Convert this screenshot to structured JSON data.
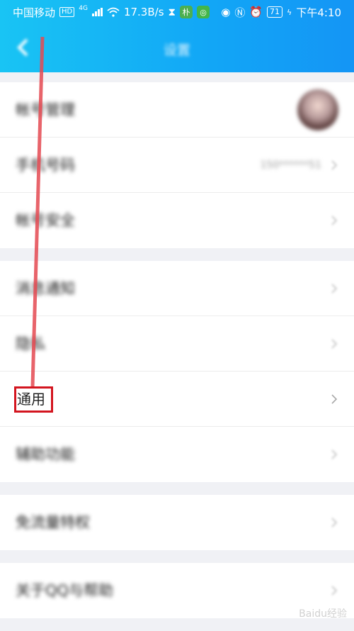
{
  "status_bar": {
    "carrier": "中国移动",
    "hd": "HD",
    "network": "4G",
    "speed": "17.3B/s",
    "app_badge": "朴",
    "battery": "71",
    "time": "下午4:10"
  },
  "nav": {
    "title": "设置"
  },
  "groups": [
    {
      "rows": [
        {
          "label": "帐号管理",
          "has_avatar": true
        },
        {
          "label": "手机号码",
          "value": "150******51"
        },
        {
          "label": "帐号安全"
        }
      ]
    },
    {
      "rows": [
        {
          "label": "消息通知"
        },
        {
          "label": "隐私"
        },
        {
          "label": "通用",
          "highlighted": true
        },
        {
          "label": "辅助功能"
        }
      ]
    },
    {
      "rows": [
        {
          "label": "免流量特权"
        }
      ]
    },
    {
      "rows": [
        {
          "label": "关于QQ与帮助"
        }
      ]
    }
  ],
  "annotation_color": "#d3151f",
  "watermark": "Baidu经验"
}
